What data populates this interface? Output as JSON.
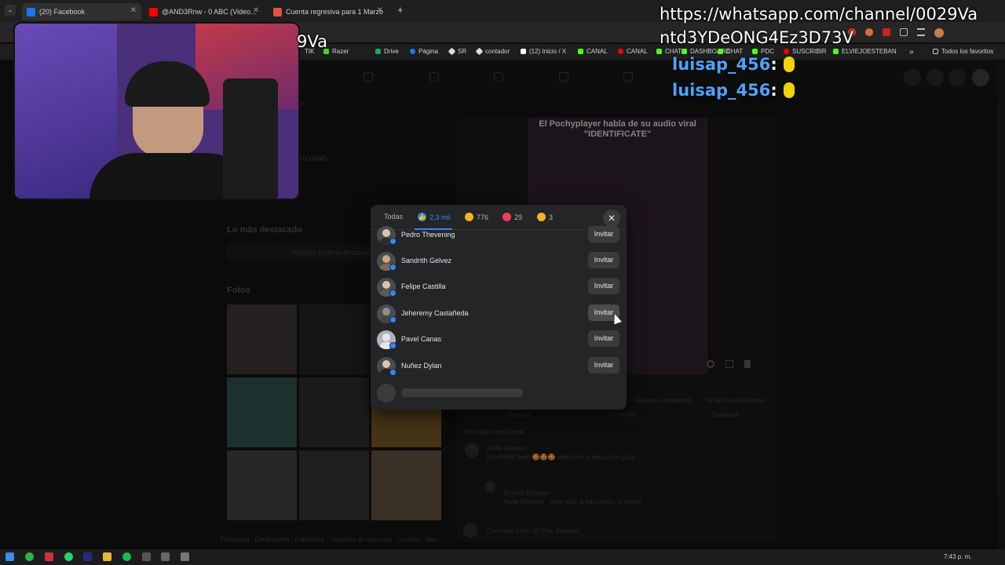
{
  "browser": {
    "tabs": [
      {
        "label": "(20) Facebook"
      },
      {
        "label": "@AND3Rnw - 0 ABC (Video..."
      },
      {
        "label": "Cuenta regresiva para 1 Marzo"
      }
    ],
    "new_tab": "+",
    "bookmarks": [
      "TIK",
      "Razer",
      "Drive",
      "Página",
      "SR",
      "contador",
      "(12) Inicio / X",
      "CANAL",
      "CANAL",
      "CHAT",
      "DASHBOARD",
      "CHAT",
      "PDC",
      "SUSCRIBIR",
      "ELVIEJOESTEBAN"
    ],
    "bookmarks_more": "»",
    "all_favorites": "Todos los favoritos"
  },
  "stream_overlay": {
    "whatsapp_line1": "https://whatsapp.com/channel/0029Va",
    "whatsapp_line2": "ntd3YDeONG4Ez3D73V",
    "partial_text": "9Va",
    "chat": [
      {
        "user": "luisap_456",
        "sep": ":"
      },
      {
        "user": "luisap_456",
        "sep": ":"
      }
    ]
  },
  "profile": {
    "destacado_title": "Lo más destacado",
    "destacado_action": "Agregar historia destacada",
    "photos_title": "Fotos",
    "ghost_text_1": "an",
    "ghost_text_2": "AN GANG",
    "footer": "Privacidad · Condiciones · Publicidad · Opciones de anuncios · Cookies · Más"
  },
  "post": {
    "video_title": "El Pochyplayer habla de su audio viral \"IDENTIFICATE\"",
    "shares": "54 veces compartido",
    "views": "76 mil visualizaciones",
    "like_label": "Me gusta",
    "comment_label": "Comentar",
    "share_label": "Compartir",
    "more_comments": "Ver más comentarios",
    "comments": [
      {
        "author": "Ferlie Romero",
        "text": "Excelente tarde 🤩🤩🤩 ante todo la educación papi."
      },
      {
        "author": "Ferlie Romero",
        "text": "Ante todo la educación, si señor!"
      }
    ],
    "reply_author_tag": "El Viejo Esteban",
    "comment_as": "Comentar como El Viejo Esteban"
  },
  "reactions_modal": {
    "tabs": [
      {
        "label": "Todas"
      },
      {
        "label": "2,3 mil"
      },
      {
        "label": "776"
      },
      {
        "label": "29"
      },
      {
        "label": "3"
      }
    ],
    "close": "✕",
    "people": [
      {
        "name": "Pedro Thevening",
        "action": "Invitar"
      },
      {
        "name": "Sandrith Gelvez",
        "action": "Invitar"
      },
      {
        "name": "Felipe Castilla",
        "action": "Invitar"
      },
      {
        "name": "Jeheremy Castañeda",
        "action": "Invitar"
      },
      {
        "name": "Pavel Canas",
        "action": "Invitar"
      },
      {
        "name": "Nuñez Dylan",
        "action": "Invitar"
      }
    ]
  },
  "taskbar": {
    "clock": "7:43 p. m."
  },
  "colors": {
    "accent_blue": "#2d88ff",
    "modal_bg": "#242526",
    "button_bg": "#3a3b3c"
  }
}
